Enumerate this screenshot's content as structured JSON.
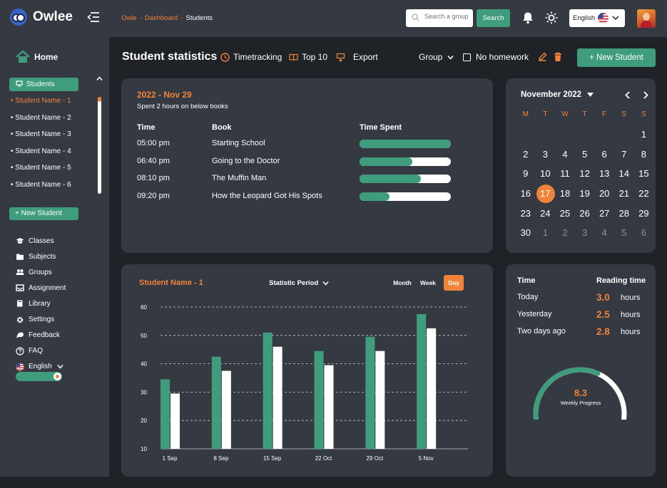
{
  "app": {
    "name": "Owlee"
  },
  "breadcrumb": {
    "items": [
      "Owle",
      "Dashboard",
      "Students"
    ],
    "separator": "-"
  },
  "search": {
    "placeholder": "Search a group",
    "button_label": "Search"
  },
  "language_select": {
    "value": "English",
    "flag_icon": "us-flag-icon"
  },
  "sidebar": {
    "home_label": "Home",
    "students_label": "Students",
    "students": [
      "Student Name - 1",
      "Student Name - 2",
      "Student Name - 3",
      "Student Name - 4",
      "Student Name - 5",
      "Student Name - 6"
    ],
    "active_student_index": 0,
    "new_student_label": "+  New Student",
    "nav": [
      {
        "label": "Classes",
        "icon": "graduation-cap-icon"
      },
      {
        "label": "Subjects",
        "icon": "folder-icon"
      },
      {
        "label": "Groups",
        "icon": "users-icon"
      },
      {
        "label": "Assignment",
        "icon": "inbox-icon"
      },
      {
        "label": "Library",
        "icon": "book-icon"
      },
      {
        "label": "Settings",
        "icon": "gear-icon"
      },
      {
        "label": "Feedback",
        "icon": "feedback-icon"
      },
      {
        "label": "FAQ",
        "icon": "question-icon"
      },
      {
        "label": "English",
        "icon": "us-flag-icon"
      }
    ],
    "theme_toggle_on": true
  },
  "actionbar": {
    "title": "Student statistics",
    "timetracking_label": "Timetracking",
    "top10_label": "Top 10",
    "export_label": "Export",
    "group_label": "Group",
    "no_homework_label": "No homework",
    "new_student_label": "+ New Student"
  },
  "books": {
    "date": "2022 - Nov 29",
    "subtitle": "Spent 2 hours on below books",
    "headers": {
      "time": "Time",
      "book": "Book",
      "time_spent": "Time Spent"
    },
    "rows": [
      {
        "time": "05:00 pm",
        "book": "Starting School",
        "progress": 1.0
      },
      {
        "time": "06:40 pm",
        "book": "Going to the Doctor",
        "progress": 0.58
      },
      {
        "time": "08:10 pm",
        "book": "The Muffin Man",
        "progress": 0.67
      },
      {
        "time": "09:20 pm",
        "book": "How the Leopard Got His Spots",
        "progress": 0.33
      }
    ]
  },
  "calendar": {
    "month_label": "November 2022",
    "weekdays": [
      "M",
      "T",
      "W",
      "T",
      "F",
      "S",
      "S"
    ],
    "weeks": [
      [
        {
          "d": "",
          "m": false
        },
        {
          "d": "",
          "m": false
        },
        {
          "d": "",
          "m": false
        },
        {
          "d": "",
          "m": false
        },
        {
          "d": "",
          "m": false
        },
        {
          "d": "",
          "m": false
        },
        {
          "d": "1",
          "m": false
        }
      ],
      [
        {
          "d": "2",
          "m": false
        },
        {
          "d": "3",
          "m": false
        },
        {
          "d": "4",
          "m": false
        },
        {
          "d": "5",
          "m": false
        },
        {
          "d": "6",
          "m": false
        },
        {
          "d": "7",
          "m": false
        },
        {
          "d": "8",
          "m": false
        }
      ],
      [
        {
          "d": "9",
          "m": false
        },
        {
          "d": "10",
          "m": false
        },
        {
          "d": "11",
          "m": false
        },
        {
          "d": "12",
          "m": false
        },
        {
          "d": "13",
          "m": false
        },
        {
          "d": "14",
          "m": false
        },
        {
          "d": "15",
          "m": false
        }
      ],
      [
        {
          "d": "16",
          "m": false
        },
        {
          "d": "17",
          "m": false,
          "today": true
        },
        {
          "d": "18",
          "m": false
        },
        {
          "d": "19",
          "m": false
        },
        {
          "d": "20",
          "m": false
        },
        {
          "d": "21",
          "m": false
        },
        {
          "d": "22",
          "m": false
        }
      ],
      [
        {
          "d": "23",
          "m": false
        },
        {
          "d": "24",
          "m": false
        },
        {
          "d": "25",
          "m": false
        },
        {
          "d": "26",
          "m": false
        },
        {
          "d": "27",
          "m": false
        },
        {
          "d": "28",
          "m": false
        },
        {
          "d": "29",
          "m": false
        }
      ],
      [
        {
          "d": "30",
          "m": false
        },
        {
          "d": "1",
          "m": true
        },
        {
          "d": "2",
          "m": true
        },
        {
          "d": "3",
          "m": true
        },
        {
          "d": "4",
          "m": true
        },
        {
          "d": "5",
          "m": true
        },
        {
          "d": "6",
          "m": true
        }
      ]
    ]
  },
  "statistics": {
    "student_label": "Student Name - 1",
    "period_label": "Statistic Period",
    "tabs": [
      "Month",
      "Week",
      "Day"
    ],
    "active_tab": "Day"
  },
  "chart_data": {
    "type": "bar",
    "categories": [
      "1 Sep",
      "8 Sep",
      "15 Sep",
      "22 Oct",
      "29 Oct",
      "5 Nov"
    ],
    "series": [
      {
        "values": [
          34.5,
          42.5,
          51,
          44.5,
          49.5,
          57.5
        ],
        "color": "#3f9d7e"
      },
      {
        "values": [
          29.5,
          37.5,
          46,
          39.5,
          44.5,
          52.5
        ],
        "color": "#ffffff"
      }
    ],
    "yticks": [
      10,
      20,
      30,
      40,
      50,
      60
    ],
    "ylim": [
      10,
      60
    ],
    "grid": true
  },
  "reading": {
    "headers": {
      "time": "Time",
      "reading": "Reading time"
    },
    "rows": [
      {
        "label": "Today",
        "value": "3.0",
        "unit": "hours"
      },
      {
        "label": "Yesterday",
        "value": "2.5",
        "unit": "hours"
      },
      {
        "label": "Two days ago",
        "value": "2.8",
        "unit": "hours"
      }
    ],
    "weekly_progress_value": "8.3",
    "weekly_progress_label": "Weekly Progress",
    "weekly_progress_fraction": 0.62
  },
  "colors": {
    "accent_green": "#3f9d7e",
    "accent_orange": "#f0823a",
    "panel": "#353a42",
    "background": "#1f2328"
  }
}
